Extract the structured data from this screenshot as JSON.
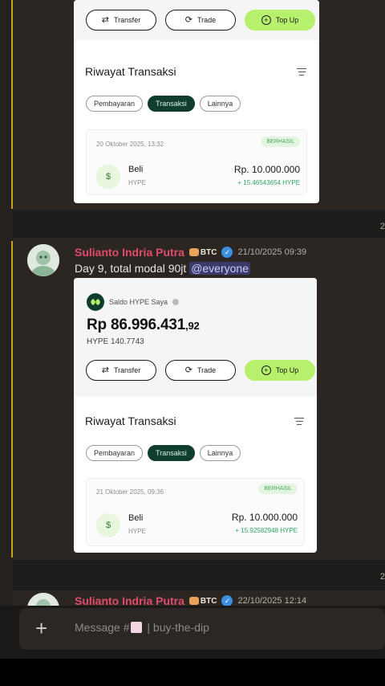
{
  "channel": {
    "placeholder_prefix": "Message #",
    "placeholder_suffix": "| buy-the-dip",
    "add_icon": "plus-icon"
  },
  "edge_times": [
    "2",
    "2"
  ],
  "card1": {
    "buttons": {
      "transfer": "Transfer",
      "trade": "Trade",
      "topup": "Top Up"
    },
    "history_title": "Riwayat Transaksi",
    "chips": [
      "Pembayaran",
      "Transaksi",
      "Lainnya"
    ],
    "tx": {
      "date": "20 Oktober 2025, 13:32",
      "status": "BERHASIL",
      "type": "Beli",
      "sub": "HYPE",
      "amount": "Rp. 10.000.000",
      "hype": "+ 15.46543654 HYPE"
    }
  },
  "message2": {
    "username": "Sulianto Indria Putra",
    "role": "BTC",
    "timestamp": "21/10/2025 09:39",
    "text": "Day 9, total modal 90jt",
    "mention": "@everyone",
    "card": {
      "wallet_label": "Saldo HYPE Saya",
      "balance_main": "Rp 86.996.431",
      "balance_dec": ",92",
      "hype_amount": "HYPE 140.7743",
      "buttons": {
        "transfer": "Transfer",
        "trade": "Trade",
        "topup": "Top Up"
      },
      "history_title": "Riwayat Transaksi",
      "chips": [
        "Pembayaran",
        "Transaksi",
        "Lainnya"
      ],
      "tx": {
        "date": "21 Oktober 2025, 09:36",
        "status": "BERHASIL",
        "type": "Beli",
        "sub": "HYPE",
        "amount": "Rp. 10.000.000",
        "hype": "+ 15.92582948 HYPE"
      }
    }
  },
  "message3": {
    "username": "Sulianto Indria Putra",
    "role": "BTC",
    "timestamp": "22/10/2025 12:14"
  },
  "colors": {
    "accent_green": "#b7f06c",
    "dark_green": "#0f3d2e",
    "username_red": "#e24b6b",
    "mention_blue": "#5865f2"
  }
}
